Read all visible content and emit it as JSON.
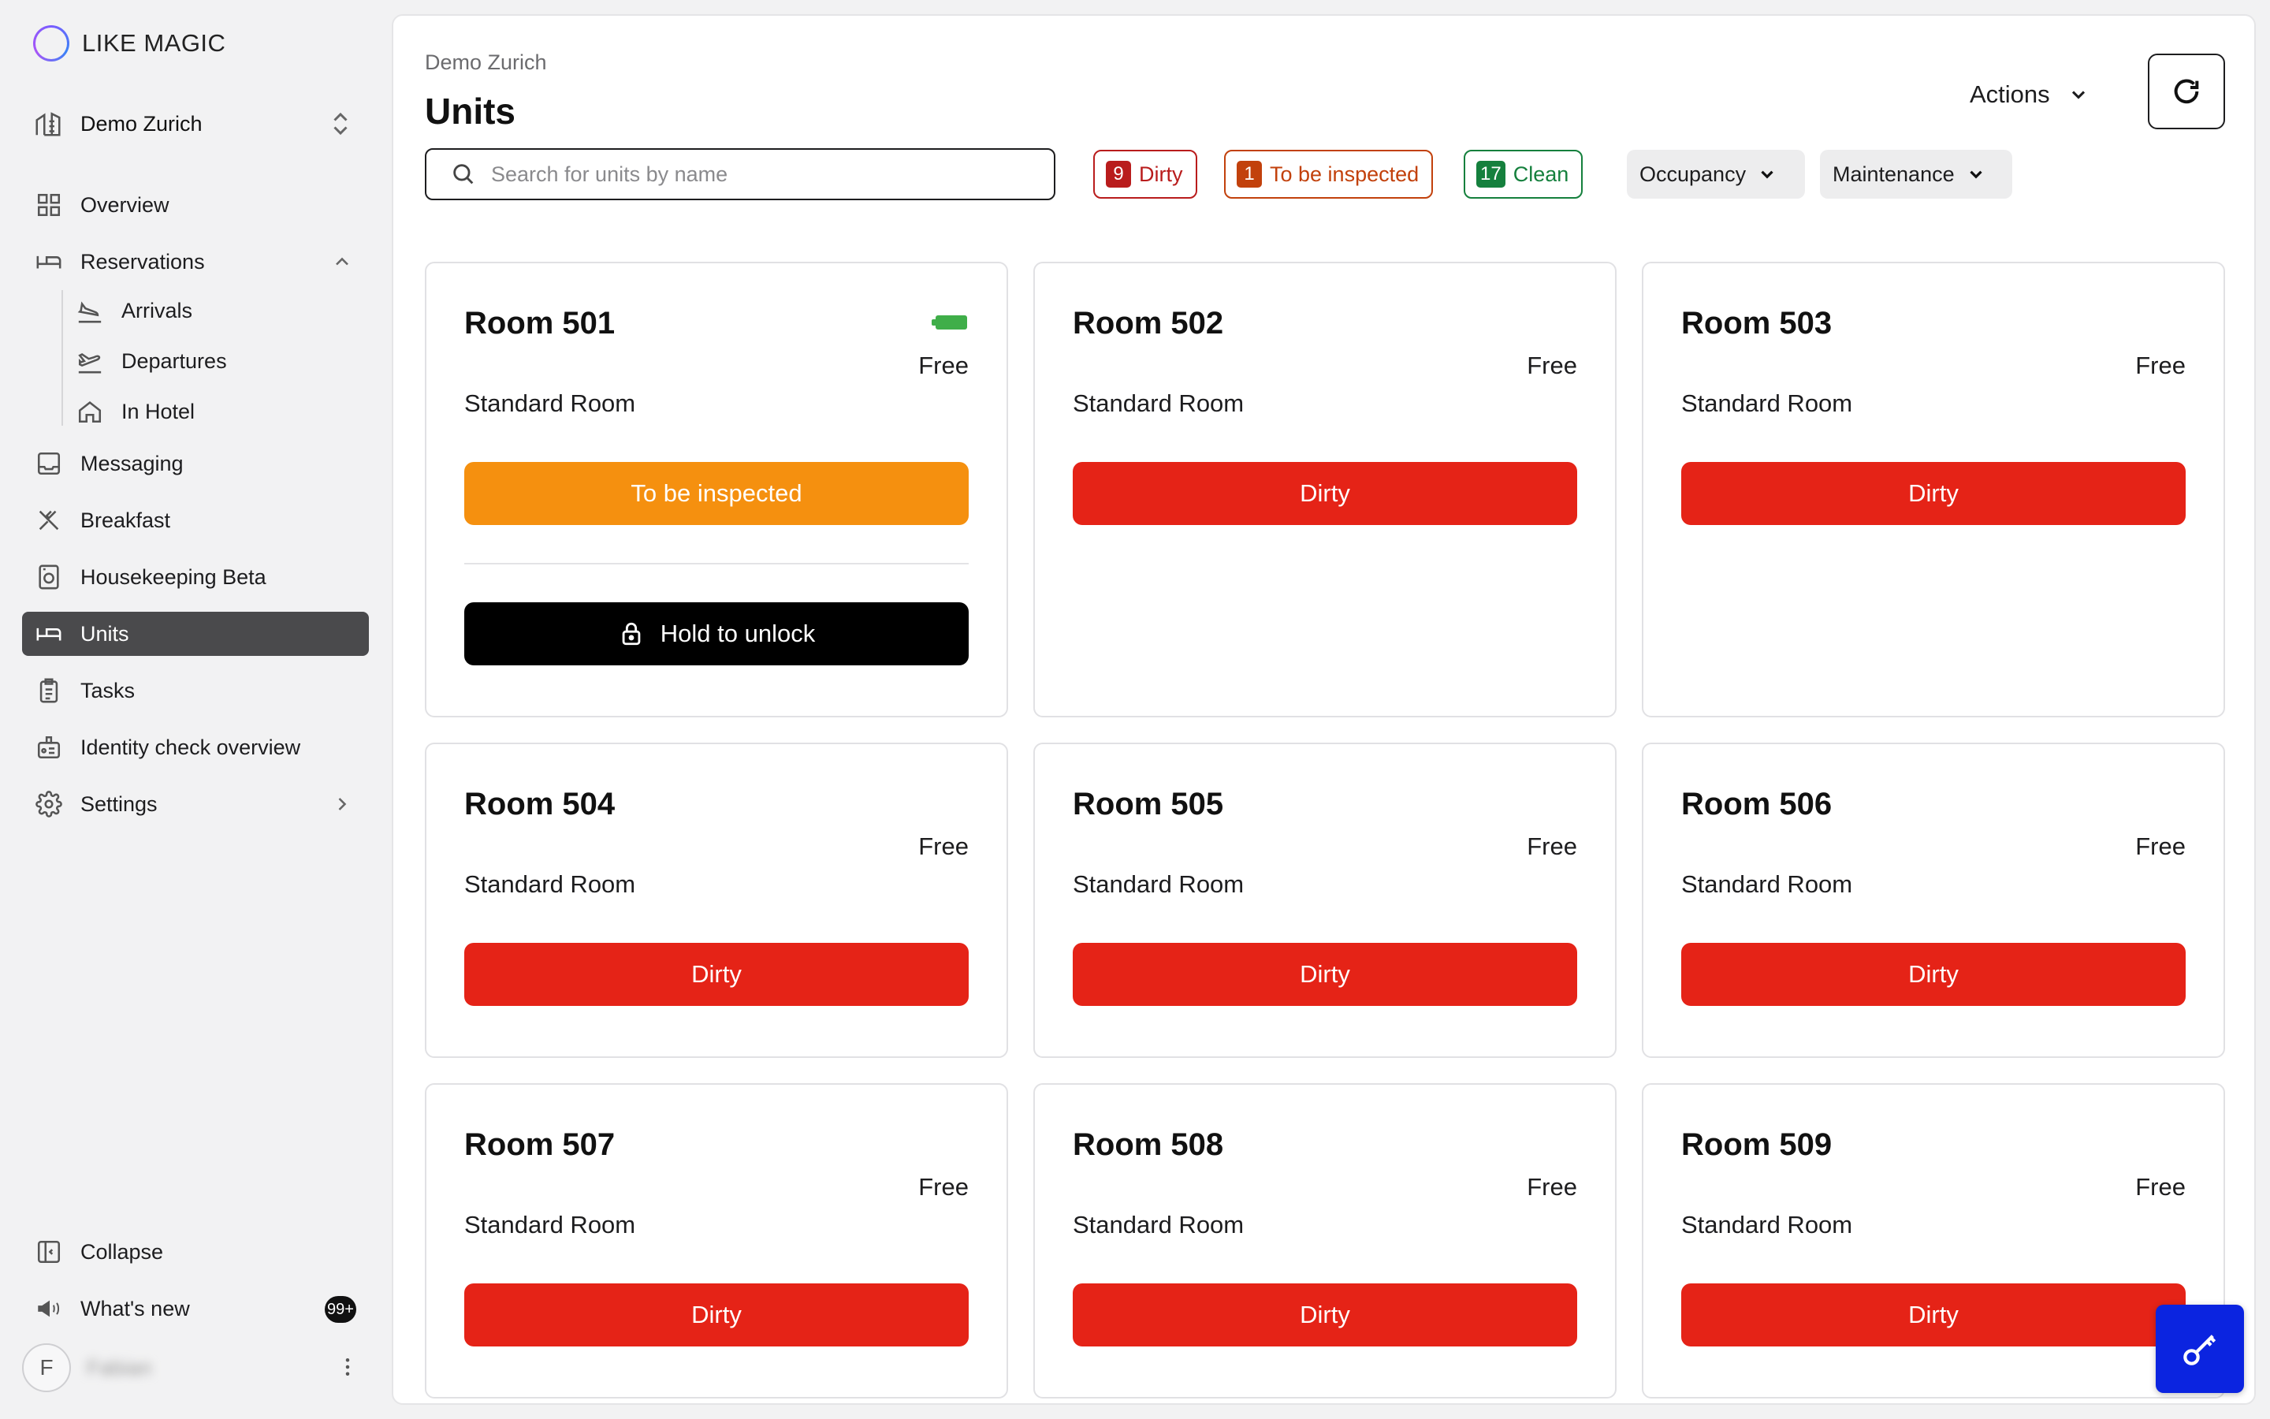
{
  "app": {
    "brand": "LIKE MAGIC"
  },
  "property": {
    "name": "Demo Zurich"
  },
  "sidebar": {
    "items": [
      {
        "label": "Overview",
        "icon": "grid-icon"
      },
      {
        "label": "Reservations",
        "icon": "bed-icon",
        "expanded": true,
        "children": [
          {
            "label": "Arrivals",
            "icon": "plane-landing-icon"
          },
          {
            "label": "Departures",
            "icon": "plane-takeoff-icon"
          },
          {
            "label": "In Hotel",
            "icon": "home-icon"
          }
        ]
      },
      {
        "label": "Messaging",
        "icon": "inbox-icon"
      },
      {
        "label": "Breakfast",
        "icon": "utensils-icon"
      },
      {
        "label": "Housekeeping Beta",
        "icon": "washing-machine-icon"
      },
      {
        "label": "Units",
        "icon": "bed-icon",
        "active": true
      },
      {
        "label": "Tasks",
        "icon": "clipboard-icon"
      },
      {
        "label": "Identity check overview",
        "icon": "id-check-icon"
      },
      {
        "label": "Settings",
        "icon": "gear-icon"
      }
    ],
    "bottom": {
      "collapse": "Collapse",
      "whats_new": "What's new",
      "whats_new_badge": "99+"
    },
    "user": {
      "initial": "F",
      "name": "Fabian"
    }
  },
  "header": {
    "breadcrumb": "Demo Zurich",
    "title": "Units",
    "actions_label": "Actions"
  },
  "filters": {
    "search_placeholder": "Search for units by name",
    "search_value": "",
    "chips": {
      "dirty": {
        "count": "9",
        "label": "Dirty"
      },
      "inspect": {
        "count": "1",
        "label": "To be inspected"
      },
      "clean": {
        "count": "17",
        "label": "Clean"
      }
    },
    "occupancy_label": "Occupancy",
    "maintenance_label": "Maintenance"
  },
  "units": [
    {
      "name": "Room 501",
      "occupancy": "Free",
      "type": "Standard Room",
      "status": "To be inspected",
      "battery": true,
      "unlock_label": "Hold to unlock"
    },
    {
      "name": "Room 502",
      "occupancy": "Free",
      "type": "Standard Room",
      "status": "Dirty"
    },
    {
      "name": "Room 503",
      "occupancy": "Free",
      "type": "Standard Room",
      "status": "Dirty"
    },
    {
      "name": "Room 504",
      "occupancy": "Free",
      "type": "Standard Room",
      "status": "Dirty"
    },
    {
      "name": "Room 505",
      "occupancy": "Free",
      "type": "Standard Room",
      "status": "Dirty"
    },
    {
      "name": "Room 506",
      "occupancy": "Free",
      "type": "Standard Room",
      "status": "Dirty"
    },
    {
      "name": "Room 507",
      "occupancy": "Free",
      "type": "Standard Room",
      "status": "Dirty"
    },
    {
      "name": "Room 508",
      "occupancy": "Free",
      "type": "Standard Room",
      "status": "Dirty"
    },
    {
      "name": "Room 509",
      "occupancy": "Free",
      "type": "Standard Room",
      "status": "Dirty"
    }
  ],
  "colors": {
    "dirty": "#e52317",
    "to_be_inspected": "#f5900f",
    "clean": "#15803d",
    "active_nav": "#4a4a4c",
    "fab": "#0b24e0"
  }
}
